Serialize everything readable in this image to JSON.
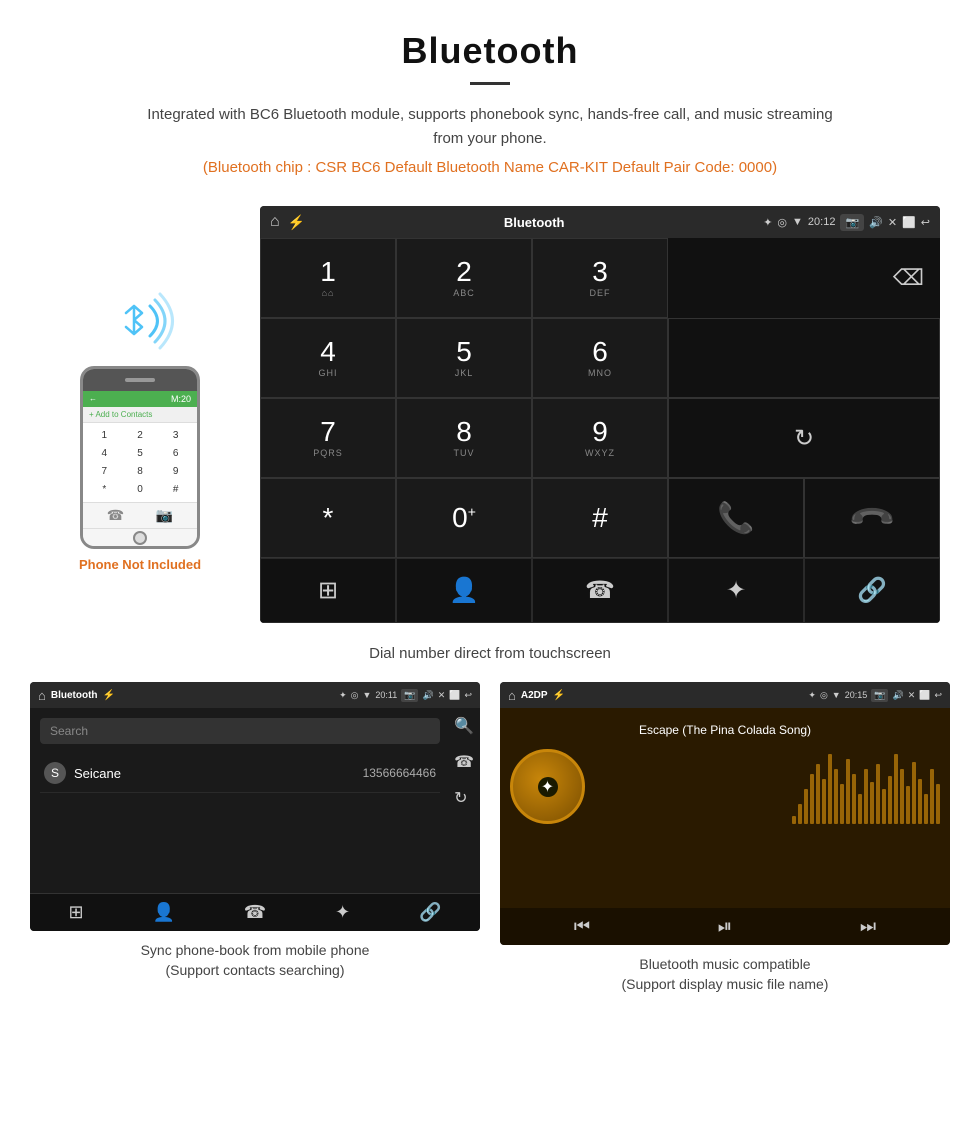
{
  "header": {
    "title": "Bluetooth",
    "description": "Integrated with BC6 Bluetooth module, supports phonebook sync, hands-free call, and music streaming from your phone.",
    "specs": "(Bluetooth chip : CSR BC6    Default Bluetooth Name CAR-KIT    Default Pair Code: 0000)"
  },
  "dial_screen": {
    "status_bar": {
      "app_name": "Bluetooth",
      "time": "20:12"
    },
    "keys": [
      {
        "number": "1",
        "sub": ""
      },
      {
        "number": "2",
        "sub": "ABC"
      },
      {
        "number": "3",
        "sub": "DEF"
      },
      {
        "number": "4",
        "sub": "GHI"
      },
      {
        "number": "5",
        "sub": "JKL"
      },
      {
        "number": "6",
        "sub": "MNO"
      },
      {
        "number": "7",
        "sub": "PQRS"
      },
      {
        "number": "8",
        "sub": "TUV"
      },
      {
        "number": "9",
        "sub": "WXYZ"
      },
      {
        "number": "*",
        "sub": ""
      },
      {
        "number": "0⁺",
        "sub": ""
      },
      {
        "number": "#",
        "sub": ""
      }
    ],
    "caption": "Dial number direct from touchscreen"
  },
  "phone_mockup": {
    "not_included_label": "Phone Not Included",
    "dialpad_keys": [
      "1",
      "2",
      "3",
      "4",
      "5",
      "6",
      "7",
      "8",
      "9",
      "*",
      "0",
      "#"
    ]
  },
  "phonebook_screen": {
    "status_bar_app": "Bluetooth",
    "search_placeholder": "Search",
    "contacts": [
      {
        "initial": "S",
        "name": "Seicane",
        "number": "13566664466"
      }
    ],
    "caption_line1": "Sync phone-book from mobile phone",
    "caption_line2": "(Support contacts searching)"
  },
  "music_screen": {
    "status_bar_app": "A2DP",
    "time": "20:15",
    "song_title": "Escape (The Pina Colada Song)",
    "caption_line1": "Bluetooth music compatible",
    "caption_line2": "(Support display music file name)"
  },
  "eq_bars": [
    8,
    20,
    35,
    50,
    60,
    45,
    70,
    55,
    40,
    65,
    50,
    30,
    55,
    42,
    60,
    35,
    48,
    70,
    55,
    38,
    62,
    45,
    30,
    55,
    40
  ]
}
